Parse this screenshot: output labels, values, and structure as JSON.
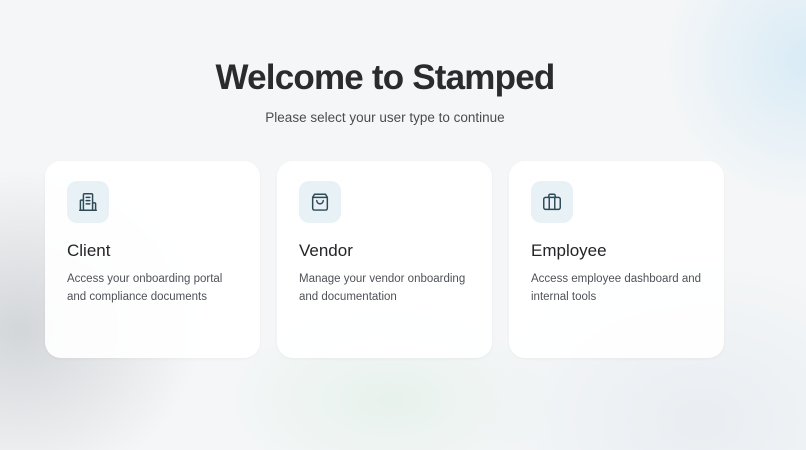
{
  "header": {
    "title": "Welcome to Stamped",
    "subtitle": "Please select your user type to continue"
  },
  "cards": [
    {
      "title": "Client",
      "description": "Access your onboarding portal and compliance documents",
      "icon": "building-icon"
    },
    {
      "title": "Vendor",
      "description": "Manage your vendor onboarding and documentation",
      "icon": "shopping-bag-icon"
    },
    {
      "title": "Employee",
      "description": "Access employee dashboard and internal tools",
      "icon": "briefcase-icon"
    }
  ],
  "colors": {
    "icon_background": "#e7f1f6",
    "icon_stroke": "#2f4a57",
    "card_background": "#ffffff",
    "page_background": "#f4f6f7"
  }
}
